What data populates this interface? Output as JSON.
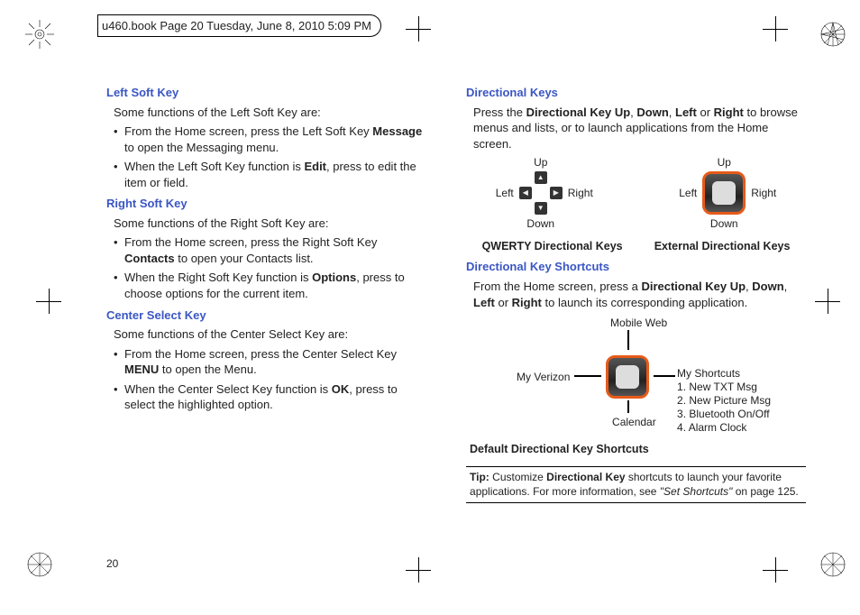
{
  "header": "u460.book  Page 20  Tuesday, June 8, 2010  5:09 PM",
  "page_number": "20",
  "left_col": {
    "lsk": {
      "heading": "Left Soft Key",
      "intro": "Some functions of the Left Soft Key are:",
      "b1a": "From the Home screen, press the Left Soft Key ",
      "b1b": "Message",
      "b1c": " to open the Messaging menu.",
      "b2a": "When the Left Soft Key function is ",
      "b2b": "Edit",
      "b2c": ", press to edit the item or field."
    },
    "rsk": {
      "heading": "Right Soft Key",
      "intro": "Some functions of the Right Soft Key are:",
      "b1a": "From the Home screen, press the Right Soft Key ",
      "b1b": "Contacts",
      "b1c": " to open your Contacts list.",
      "b2a": "When the Right Soft Key function is ",
      "b2b": "Options",
      "b2c": ", press to choose options for the current item."
    },
    "csk": {
      "heading": "Center Select Key",
      "intro": "Some functions of the Center Select Key are:",
      "b1a": "From the Home screen, press the Center Select Key ",
      "b1b": "MENU",
      "b1c": " to open the Menu.",
      "b2a": "When the Center Select Key function is ",
      "b2b": "OK",
      "b2c": ", press to select the highlighted option."
    }
  },
  "right_col": {
    "dk": {
      "heading": "Directional Keys",
      "p1a": "Press the ",
      "p1b": "Directional Key Up",
      "p1c": ", ",
      "p1d": "Down",
      "p1e": ", ",
      "p1f": "Left",
      "p1g": " or ",
      "p1h": "Right",
      "p1i": " to browse menus and lists, or to launch applications from the Home screen."
    },
    "labels": {
      "up": "Up",
      "down": "Down",
      "left": "Left",
      "right": "Right"
    },
    "cap_qwerty": "QWERTY Directional Keys",
    "cap_ext": "External Directional Keys",
    "dks": {
      "heading": "Directional Key Shortcuts",
      "p1a": "From the Home screen, press a ",
      "p1b": "Directional Key Up",
      "p1c": ", ",
      "p1d": "Down",
      "p1e": ", ",
      "p1f": "Left",
      "p1g": " or ",
      "p1h": "Right",
      "p1i": " to launch its corresponding application."
    },
    "shortcut": {
      "up": "Mobile Web",
      "down": "Calendar",
      "left": "My Verizon",
      "right": "My Shortcuts",
      "list1": "1. New TXT Msg",
      "list2": "2. New Picture Msg",
      "list3": "3. Bluetooth On/Off",
      "list4": "4. Alarm Clock",
      "caption": "Default Directional Key Shortcuts"
    },
    "tip": {
      "lead": "Tip:",
      "t1": " Customize ",
      "t2": "Directional Key",
      "t3": " shortcuts to launch your favorite applications. For more information, see ",
      "t4": "\"Set Shortcuts\"",
      "t5": " on page 125."
    }
  }
}
